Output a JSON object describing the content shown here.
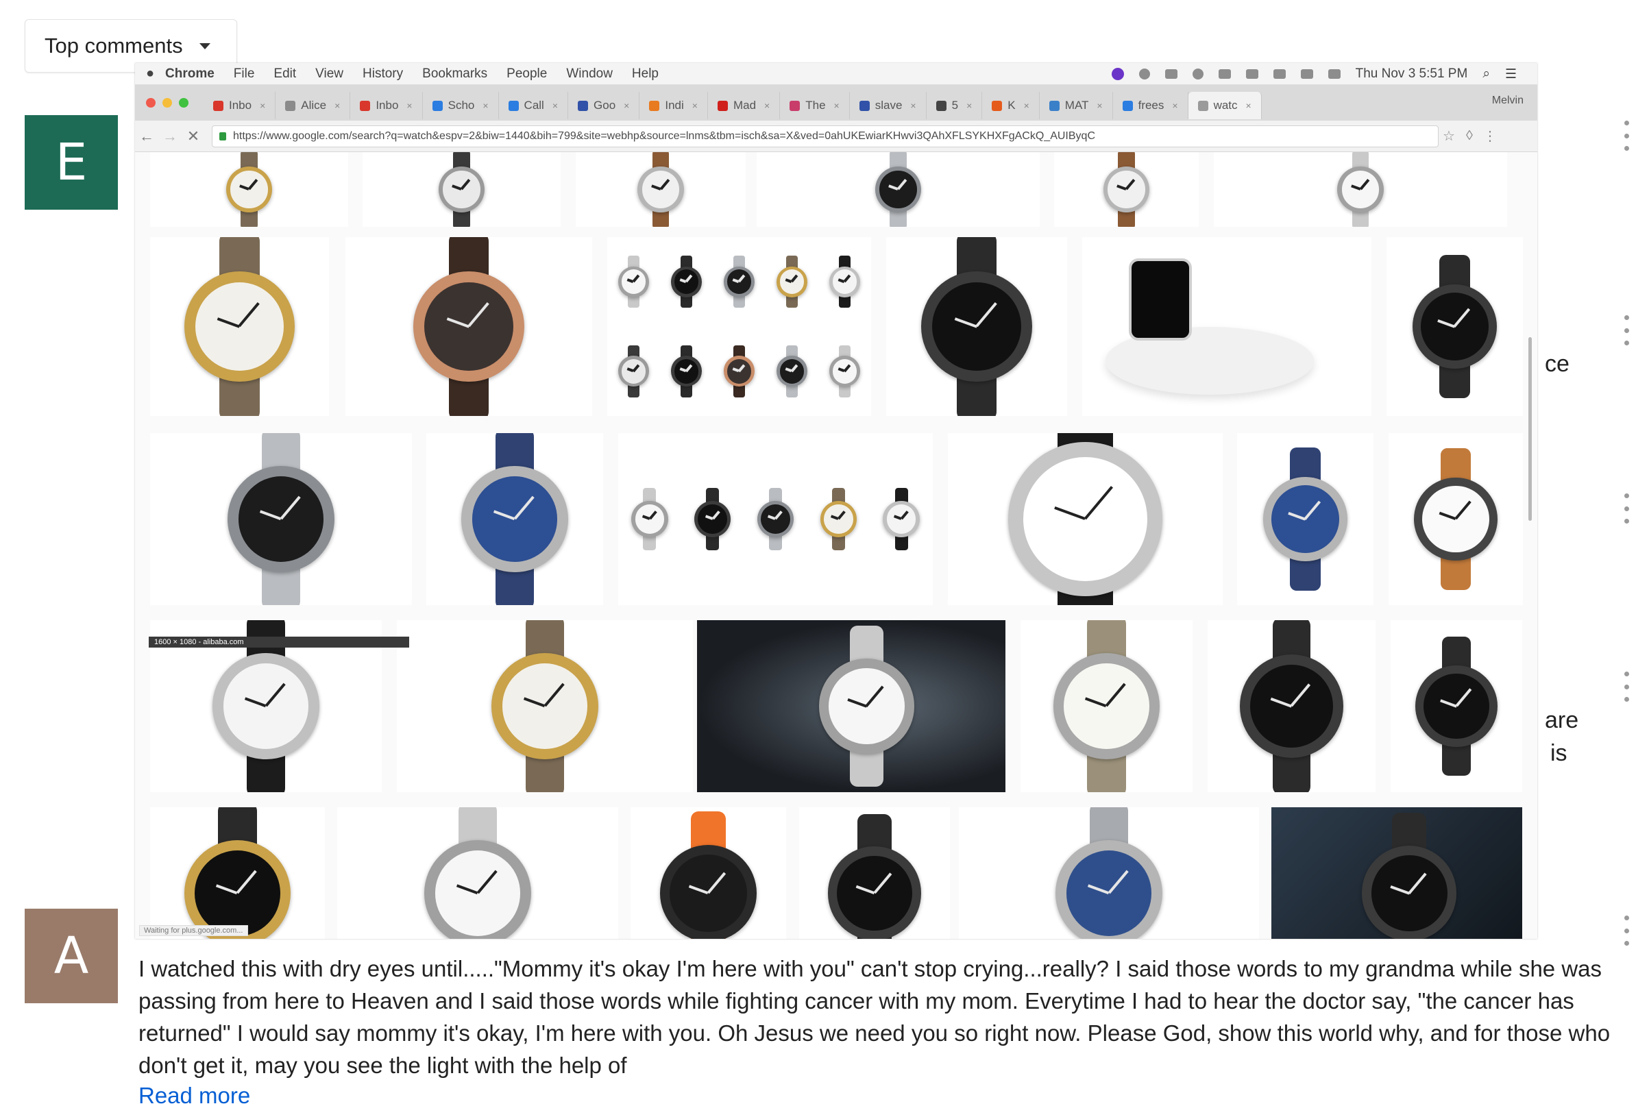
{
  "sort": {
    "label": "Top comments",
    "icon": "caret-down-icon"
  },
  "avatars": [
    {
      "letter": "E",
      "color": "#1d6b55"
    },
    {
      "letter": "A",
      "color": "#9a7b6a"
    }
  ],
  "peek_text": [
    "ce",
    "are",
    "is"
  ],
  "browser": {
    "menubar": {
      "items": [
        "Chrome",
        "File",
        "Edit",
        "View",
        "History",
        "Bookmarks",
        "People",
        "Window",
        "Help"
      ],
      "clock": "Thu Nov 3 5:51 PM"
    },
    "tabs": [
      {
        "label": "Inbo",
        "fav": "#d9372c"
      },
      {
        "label": "Alice",
        "fav": "#8a8a8a"
      },
      {
        "label": "Inbo",
        "fav": "#d9372c"
      },
      {
        "label": "Scho",
        "fav": "#2b7de1"
      },
      {
        "label": "Call",
        "fav": "#2b7de1"
      },
      {
        "label": "Goo",
        "fav": "#3152a8"
      },
      {
        "label": "Indi",
        "fav": "#e87a1f"
      },
      {
        "label": "Mad",
        "fav": "#d0201b"
      },
      {
        "label": "The",
        "fav": "#c93d6b"
      },
      {
        "label": "slave",
        "fav": "#3152a8"
      },
      {
        "label": "5",
        "fav": "#444444"
      },
      {
        "label": "K",
        "fav": "#e55b1c"
      },
      {
        "label": "MAT",
        "fav": "#3a80c9"
      },
      {
        "label": "frees",
        "fav": "#2b7de1"
      },
      {
        "label": "watc",
        "fav": "#9a9a9a"
      }
    ],
    "profile": "Melvin",
    "url": "https://www.google.com/search?q=watch&espv=2&biw=1440&bih=799&site=webhp&source=lnms&tbm=isch&sa=X&ved=0ahUKEwiarKHwvi3QAhXFLSYKHXFgACkQ_AUIByqC",
    "dimension_tag": "1600 × 1080 - alibaba.com",
    "status_text": "Waiting for plus.google.com..."
  },
  "comment": {
    "text": "I watched this with dry eyes until.....\"Mommy it's okay I'm here with you\" can't stop crying...really? I said those words to my grandma while she was passing from here to Heaven and I said those words while fighting cancer with my mom. Everytime I had to hear the doctor say, \"the cancer has returned\" I would say mommy it's okay, I'm here with you. Oh Jesus we need you so right now. Please God, show this world why, and for those who don't get it, may you see the light with the help of",
    "read_more": "Read more"
  }
}
